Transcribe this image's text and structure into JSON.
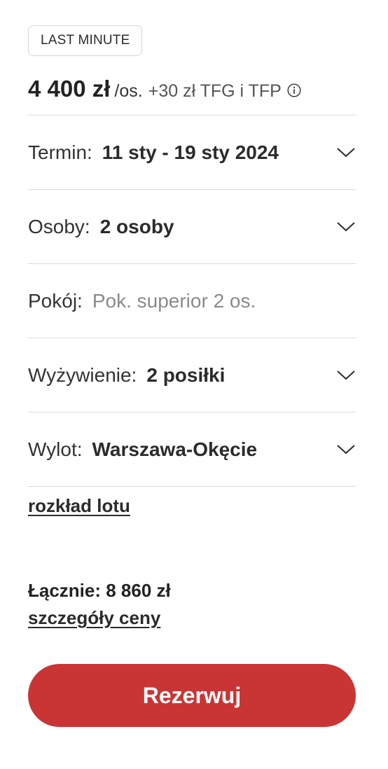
{
  "badge": "LAST MINUTE",
  "price": {
    "amount": "4 400 zł",
    "per": "/os.",
    "fee": "+30 zł TFG i TFP"
  },
  "fields": [
    {
      "label": "Termin:",
      "value": "11 sty - 19 sty 2024",
      "has_dropdown": true
    },
    {
      "label": "Osoby:",
      "value": "2 osoby",
      "has_dropdown": true
    },
    {
      "label": "Pokój:",
      "value": "Pok. superior 2 os.",
      "has_dropdown": false
    },
    {
      "label": "Wyżywienie:",
      "value": "2 posiłki",
      "has_dropdown": true
    },
    {
      "label": "Wylot:",
      "value": "Warszawa-Okęcie",
      "has_dropdown": true
    }
  ],
  "flight_schedule_link": "rozkład lotu",
  "total": "Łącznie: 8 860 zł",
  "price_details_link": "szczegóły ceny",
  "book_button": "Rezerwuj",
  "colors": {
    "accent": "#c93535",
    "text": "#2b2b2b",
    "muted": "#8a8a8a",
    "divider": "#dcdcdc"
  },
  "icons": {
    "info": "info-circle-icon",
    "dropdown": "chevron-down-icon"
  }
}
